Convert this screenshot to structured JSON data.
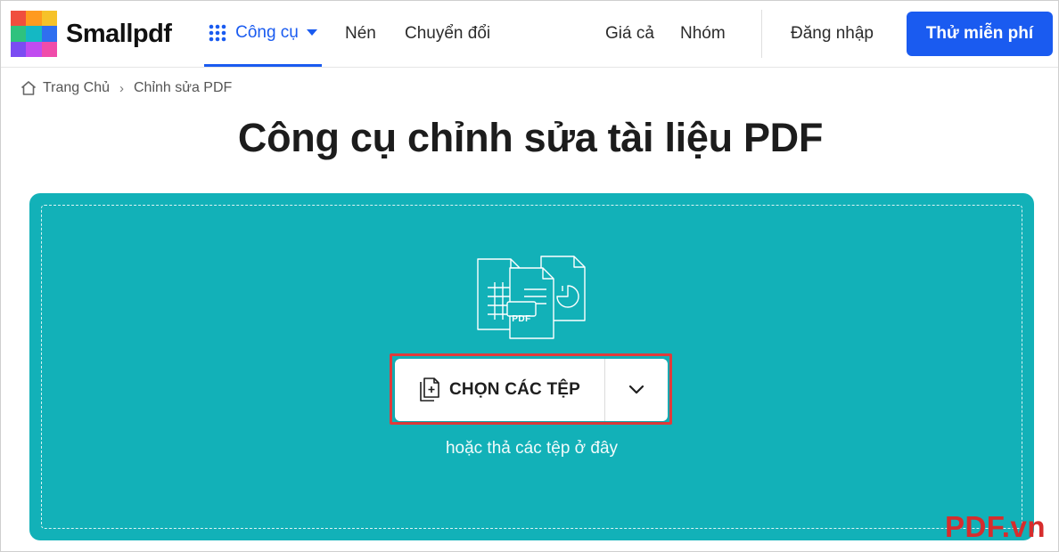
{
  "brand": {
    "name": "Smallpdf",
    "logo_colors": [
      "#f44336",
      "#ff9800",
      "#4caf50",
      "#2196f3",
      "#9c27b0",
      "#e91e63"
    ]
  },
  "nav": {
    "tools_label": "Công cụ",
    "compress_label": "Nén",
    "convert_label": "Chuyển đổi",
    "pricing_label": "Giá cả",
    "team_label": "Nhóm",
    "login_label": "Đăng nhập",
    "cta_label": "Thử miễn phí"
  },
  "breadcrumb": {
    "home_label": "Trang Chủ",
    "separator": "›",
    "current_label": "Chỉnh sửa PDF"
  },
  "page_title": "Công cụ chỉnh sửa tài liệu PDF",
  "dropzone": {
    "illustration_badge": "PDF",
    "choose_files_label": "CHỌN CÁC TỆP",
    "drop_hint": "hoặc thả các tệp ở đây",
    "background_color": "#12b1b8",
    "highlight_color": "#e03b3b"
  },
  "watermark": "PDF.vn",
  "colors": {
    "accent": "#1a5bf0"
  }
}
